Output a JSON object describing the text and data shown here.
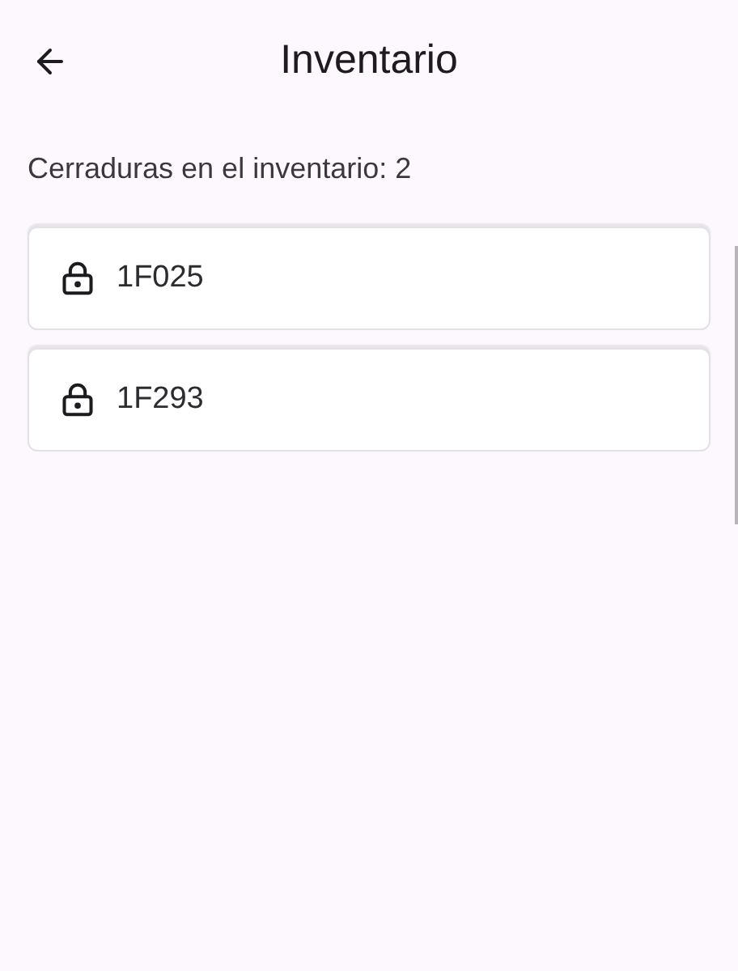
{
  "header": {
    "title": "Inventario"
  },
  "summary": "Cerraduras en el inventario: 2",
  "locks": [
    {
      "code": "1F025"
    },
    {
      "code": "1F293"
    }
  ]
}
